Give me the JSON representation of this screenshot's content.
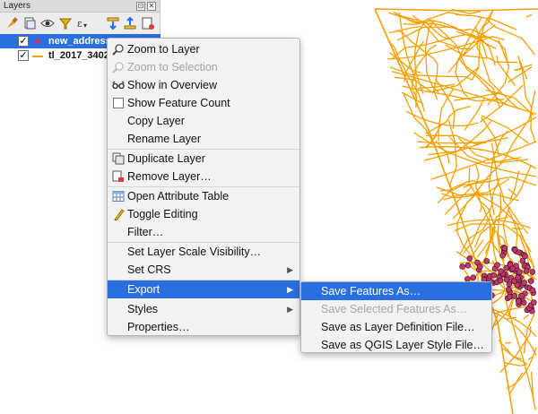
{
  "panel": {
    "title": "Layers",
    "float_btn": "⊡",
    "close_btn": "✕"
  },
  "toolbar": {
    "icons": [
      "paintbrush-icon",
      "add-group-icon",
      "eye-icon",
      "filter-icon",
      "filter-expression-icon",
      "expand-all-icon",
      "collapse-all-icon",
      "remove-layer-icon"
    ]
  },
  "layers": [
    {
      "name": "new_address",
      "checked": "✓",
      "symbol": "point",
      "selected": true
    },
    {
      "name": "tl_2017_3402",
      "checked": "✓",
      "symbol": "line",
      "selected": false
    }
  ],
  "context_menu": {
    "items": [
      {
        "label": "Zoom to Layer",
        "icon": "zoom-layer-icon",
        "enabled": true
      },
      {
        "label": "Zoom to Selection",
        "icon": "zoom-selection-icon",
        "enabled": false
      },
      {
        "label": "Show in Overview",
        "icon": "overview-icon",
        "enabled": true
      },
      {
        "label": "Show Feature Count",
        "icon": "checkbox-icon",
        "enabled": true
      },
      {
        "label": "Copy Layer",
        "icon": "",
        "enabled": true
      },
      {
        "label": "Rename Layer",
        "icon": "",
        "enabled": true
      },
      {
        "label": "Duplicate Layer",
        "icon": "duplicate-icon",
        "enabled": true
      },
      {
        "label": "Remove Layer…",
        "icon": "remove-icon",
        "enabled": true
      },
      {
        "label": "Open Attribute Table",
        "icon": "table-icon",
        "enabled": true
      },
      {
        "label": "Toggle Editing",
        "icon": "pencil-icon",
        "enabled": true
      },
      {
        "label": "Filter…",
        "icon": "",
        "enabled": true
      },
      {
        "label": "Set Layer Scale Visibility…",
        "icon": "",
        "enabled": true
      },
      {
        "label": "Set CRS",
        "icon": "",
        "enabled": true,
        "submenu": true
      },
      {
        "label": "Export",
        "icon": "",
        "enabled": true,
        "submenu": true,
        "active": true
      },
      {
        "label": "Styles",
        "icon": "",
        "enabled": true,
        "submenu": true
      },
      {
        "label": "Properties…",
        "icon": "",
        "enabled": true
      }
    ],
    "arrow": "▶"
  },
  "export_submenu": {
    "items": [
      {
        "label": "Save Features As…",
        "enabled": true,
        "active": true
      },
      {
        "label": "Save Selected Features As…",
        "enabled": false
      },
      {
        "label": "Save as Layer Definition File…",
        "enabled": true
      },
      {
        "label": "Save as QGIS Layer Style File…",
        "enabled": true
      }
    ]
  },
  "colors": {
    "road_lines": "#f5a000",
    "address_points": "#c0396b",
    "selection": "#2a6fe0"
  }
}
